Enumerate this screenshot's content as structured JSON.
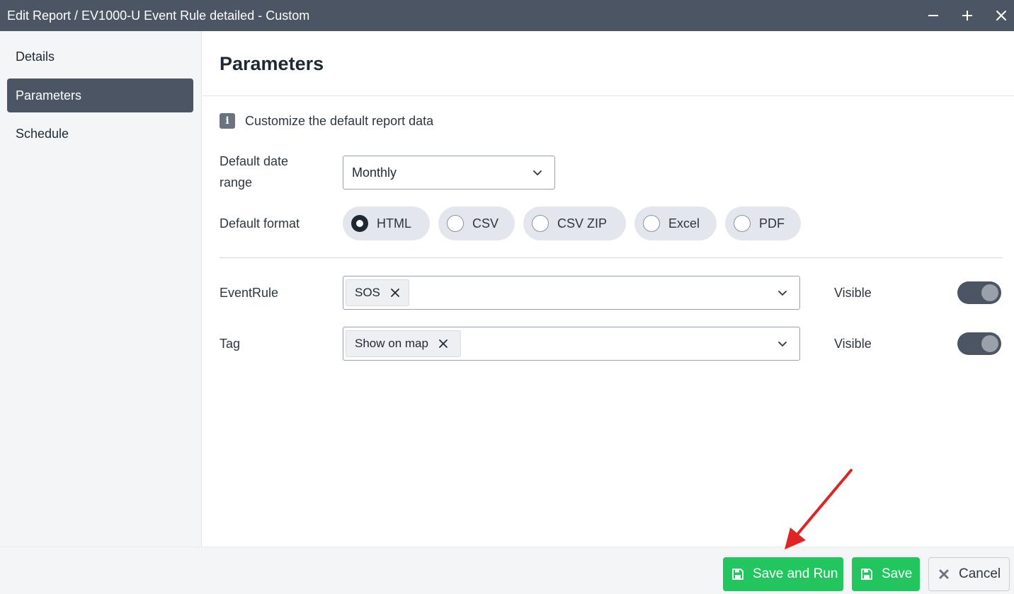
{
  "window": {
    "title": "Edit Report / EV1000-U Event Rule detailed - Custom",
    "controls": {
      "minimize": "minimize-icon",
      "maximize": "plus-icon",
      "close": "close-icon"
    }
  },
  "sidebar": {
    "items": [
      {
        "label": "Details",
        "active": false
      },
      {
        "label": "Parameters",
        "active": true
      },
      {
        "label": "Schedule",
        "active": false
      }
    ]
  },
  "main": {
    "heading": "Parameters",
    "info_text": "Customize the default report data",
    "date_range": {
      "label": "Default date range",
      "value": "Monthly"
    },
    "format": {
      "label": "Default format",
      "options": [
        {
          "label": "HTML",
          "checked": true
        },
        {
          "label": "CSV",
          "checked": false
        },
        {
          "label": "CSV ZIP",
          "checked": false
        },
        {
          "label": "Excel",
          "checked": false
        },
        {
          "label": "PDF",
          "checked": false
        }
      ]
    },
    "event_rule": {
      "label": "EventRule",
      "chips": [
        "SOS"
      ],
      "visible_label": "Visible",
      "visible": true
    },
    "tag": {
      "label": "Tag",
      "chips": [
        "Show on map"
      ],
      "visible_label": "Visible",
      "visible": true
    }
  },
  "footer": {
    "save_and_run": "Save and Run",
    "save": "Save",
    "cancel": "Cancel"
  },
  "colors": {
    "titlebar": "#4b5563",
    "accent_green": "#22c55e",
    "annotation_arrow": "#e02424"
  }
}
